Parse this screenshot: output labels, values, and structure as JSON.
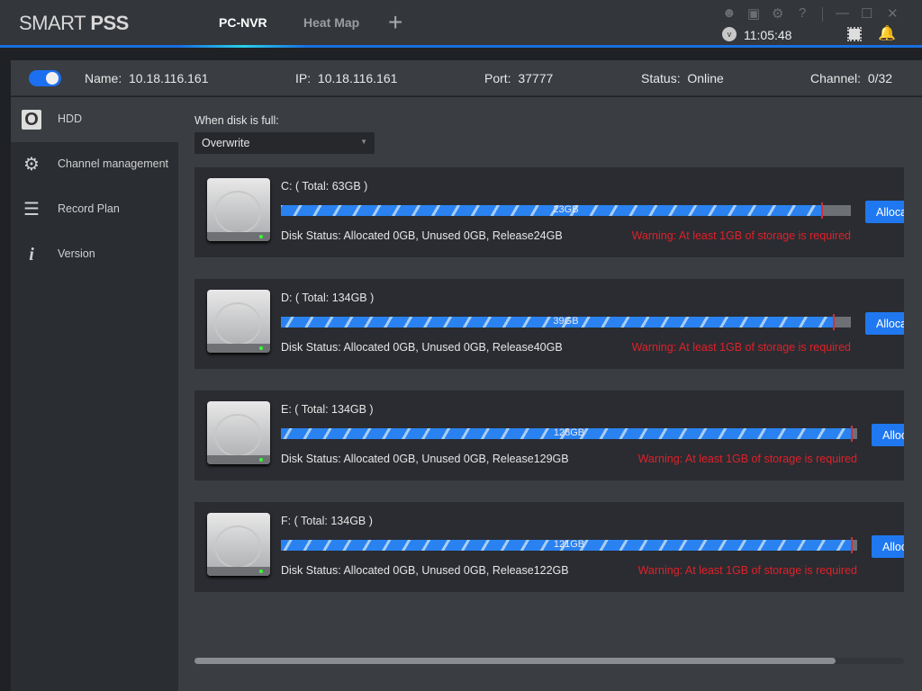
{
  "app": {
    "logo_light": "SMART ",
    "logo_bold": "PSS",
    "tabs": [
      {
        "label": "PC-NVR",
        "active": true
      },
      {
        "label": "Heat Map",
        "active": false
      }
    ],
    "add_tab": "+",
    "time": "11:05:48"
  },
  "device": {
    "enabled": true,
    "name_label": "Name:",
    "name": "10.18.116.161",
    "ip_label": "IP:",
    "ip": "10.18.116.161",
    "port_label": "Port:",
    "port": "37777",
    "status_label": "Status:",
    "status": "Online",
    "channel_label": "Channel:",
    "channel": "0/32"
  },
  "sidebar": {
    "items": [
      {
        "label": "HDD",
        "icon": "hdd-icon",
        "selected": true
      },
      {
        "label": "Channel management",
        "icon": "camera-gear-icon"
      },
      {
        "label": "Record Plan",
        "icon": "clipboard-icon"
      },
      {
        "label": "Version",
        "icon": "info-icon"
      }
    ]
  },
  "main": {
    "disk_full_label": "When disk is full:",
    "disk_full_value": "Overwrite",
    "disks": [
      {
        "title": "C: ( Total: 63GB )",
        "used": "23GB",
        "fill_pct": 95,
        "status": "Disk Status:  Allocated 0GB, Unused 0GB, Release24GB",
        "warning": "Warning: At least 1GB of storage is required",
        "button": "Allocate"
      },
      {
        "title": "D: ( Total: 134GB )",
        "used": "39GB",
        "fill_pct": 97,
        "status": "Disk Status:  Allocated 0GB, Unused 0GB, Release40GB",
        "warning": "Warning: At least 1GB of storage is required",
        "button": "Allocate"
      },
      {
        "title": "E: ( Total: 134GB )",
        "used": "128GB",
        "fill_pct": 99,
        "status": "Disk Status:  Allocated 0GB, Unused 0GB, Release129GB",
        "warning": "Warning: At least 1GB of storage is required",
        "button": "Allocate"
      },
      {
        "title": "F: ( Total: 134GB )",
        "used": "121GB",
        "fill_pct": 99,
        "status": "Disk Status:  Allocated 0GB, Unused 0GB, Release122GB",
        "warning": "Warning: At least 1GB of storage is required",
        "button": "Allocate"
      }
    ]
  },
  "colors": {
    "accent": "#1f78f0",
    "warning": "#e0202a",
    "online": "#e8e8e8"
  }
}
